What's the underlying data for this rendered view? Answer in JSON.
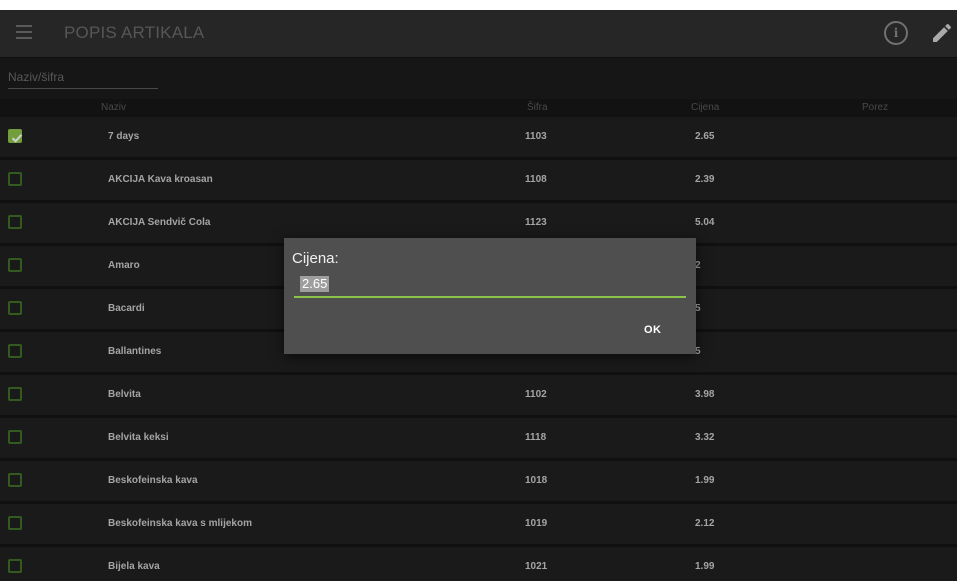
{
  "app_bar": {
    "title": "POPIS ARTIKALA",
    "menu_icon": "hamburger-menu-icon",
    "info_icon": "info-icon",
    "edit_icon": "pencil-icon"
  },
  "search": {
    "placeholder": "Naziv/šifra",
    "value": ""
  },
  "table": {
    "headers": {
      "name": "Naziv",
      "code": "Šifra",
      "price": "Cijena",
      "tax": "Porez"
    },
    "rows": [
      {
        "checked": true,
        "name": "7 days",
        "code": "1103",
        "price": "2.65",
        "tax": ""
      },
      {
        "checked": false,
        "name": "AKCIJA Kava kroasan",
        "code": "1108",
        "price": "2.39",
        "tax": ""
      },
      {
        "checked": false,
        "name": "AKCIJA Sendvič Cola",
        "code": "1123",
        "price": "5.04",
        "tax": ""
      },
      {
        "checked": false,
        "name": "Amaro",
        "code": "",
        "price": "2",
        "tax": ""
      },
      {
        "checked": false,
        "name": "Bacardi",
        "code": "",
        "price": "5",
        "tax": ""
      },
      {
        "checked": false,
        "name": "Ballantines",
        "code": "",
        "price": "5",
        "tax": ""
      },
      {
        "checked": false,
        "name": "Belvita",
        "code": "1102",
        "price": "3.98",
        "tax": ""
      },
      {
        "checked": false,
        "name": "Belvita keksi",
        "code": "1118",
        "price": "3.32",
        "tax": ""
      },
      {
        "checked": false,
        "name": "Beskofeinska kava",
        "code": "1018",
        "price": "1.99",
        "tax": ""
      },
      {
        "checked": false,
        "name": "Beskofeinska kava s mlijekom",
        "code": "1019",
        "price": "2.12",
        "tax": ""
      },
      {
        "checked": false,
        "name": "Bijela kava",
        "code": "1021",
        "price": "1.99",
        "tax": ""
      }
    ]
  },
  "dialog": {
    "title": "Cijena:",
    "value": "2.65",
    "ok_label": "OK"
  },
  "colors": {
    "accent": "#8bc34a",
    "app_bar": "#2f2f2f",
    "background": "#1c1c1c",
    "row": "#202020",
    "dialog": "#4f4f4f"
  }
}
